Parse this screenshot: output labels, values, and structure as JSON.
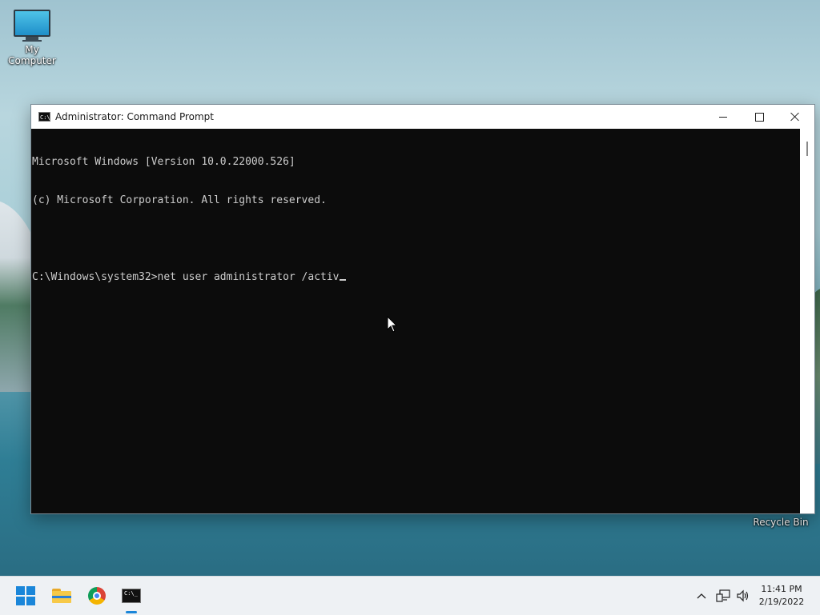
{
  "desktop": {
    "icons": [
      {
        "label": "My Computer",
        "icon": "monitor-icon"
      },
      {
        "label": "Recycle Bin",
        "icon": "recycle-bin-icon"
      }
    ]
  },
  "window": {
    "title": "Administrator: Command Prompt",
    "icon": "cmd-icon",
    "icon_glyph": "C:\\_",
    "controls": {
      "minimize": "minimize-icon",
      "maximize": "maximize-icon",
      "close": "close-icon"
    }
  },
  "console": {
    "lines": [
      "Microsoft Windows [Version 10.0.22000.526]",
      "(c) Microsoft Corporation. All rights reserved.",
      "",
      "C:\\Windows\\system32>net user administrator /activ"
    ]
  },
  "taskbar": {
    "apps": [
      {
        "name": "Start",
        "icon": "windows-logo-icon"
      },
      {
        "name": "File Explorer",
        "icon": "folder-icon"
      },
      {
        "name": "Google Chrome",
        "icon": "chrome-icon"
      },
      {
        "name": "Command Prompt",
        "icon": "cmd-icon",
        "active": true
      }
    ],
    "tray": {
      "chevron": "˄",
      "network": "🖧",
      "volume": "🔊"
    },
    "clock": {
      "time": "11:41 PM",
      "date": "2/19/2022"
    }
  },
  "colors": {
    "console_bg": "#0c0c0c",
    "console_text": "#cccccc",
    "accent": "#1a86d9"
  }
}
